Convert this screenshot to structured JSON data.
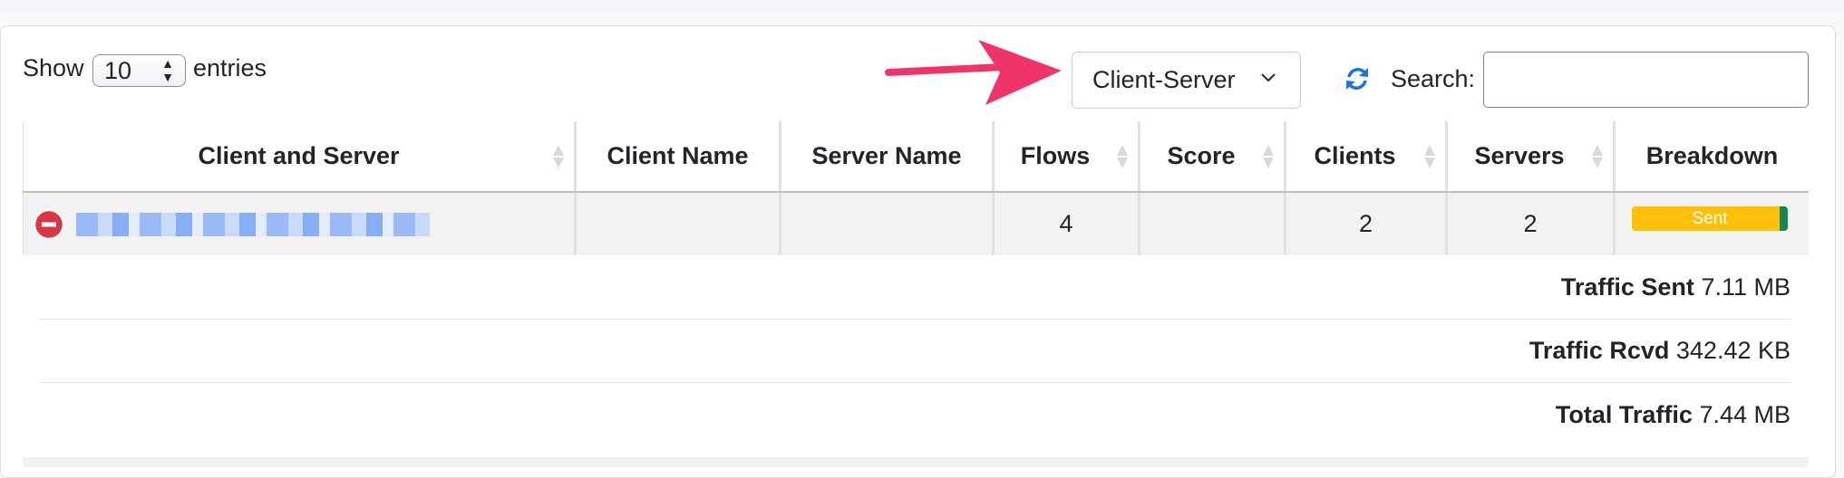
{
  "length_control": {
    "show_label": "Show",
    "value": "10",
    "entries_label": "entries"
  },
  "view_dropdown": {
    "value": "Client-Server"
  },
  "search": {
    "label": "Search:",
    "value": ""
  },
  "columns": [
    {
      "label": "Client and Server",
      "sortable": true
    },
    {
      "label": "Client Name",
      "sortable": false
    },
    {
      "label": "Server Name",
      "sortable": false
    },
    {
      "label": "Flows",
      "sortable": true
    },
    {
      "label": "Score",
      "sortable": true
    },
    {
      "label": "Clients",
      "sortable": true
    },
    {
      "label": "Servers",
      "sortable": true
    },
    {
      "label": "Breakdown",
      "sortable": false
    }
  ],
  "rows": [
    {
      "client_and_server": "",
      "client_name": "",
      "server_name": "",
      "flows": "4",
      "score": "",
      "clients": "2",
      "servers": "2",
      "breakdown": {
        "sent_label": "Sent",
        "sent_fraction": 0.95
      }
    }
  ],
  "details": [
    {
      "label": "Traffic Sent",
      "value": "7.11 MB"
    },
    {
      "label": "Traffic Rcvd",
      "value": "342.42 KB"
    },
    {
      "label": "Total Traffic",
      "value": "7.44 MB"
    }
  ],
  "colors": {
    "arrow": "#f0346a",
    "refresh": "#1a73e8",
    "sent": "#ffc107",
    "rcvd": "#198754",
    "remove": "#dc3545"
  }
}
